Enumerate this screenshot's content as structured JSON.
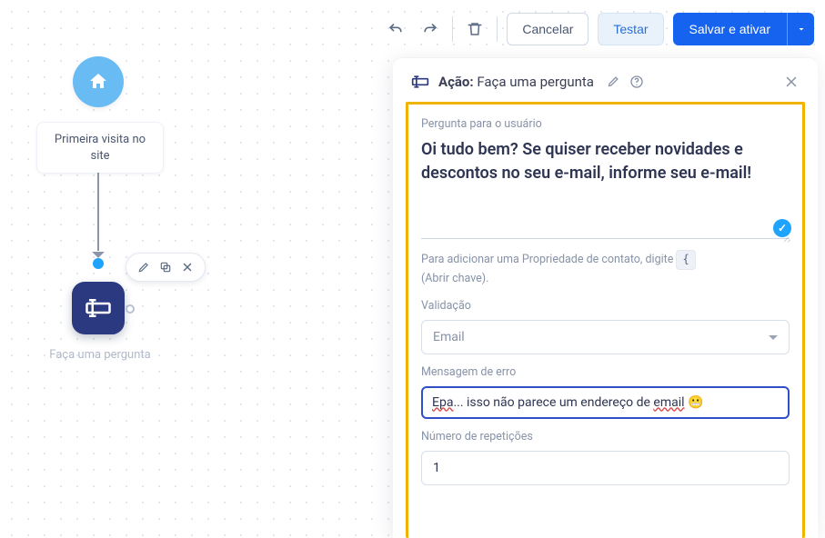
{
  "toolbar": {
    "cancel_label": "Cancelar",
    "test_label": "Testar",
    "save_label": "Salvar e ativar"
  },
  "flow": {
    "start_label": "Primeira visita no site",
    "action_label": "Faça uma pergunta"
  },
  "panel": {
    "header_prefix": "Ação:",
    "header_title": "Faça uma pergunta",
    "question_label": "Pergunta para o usuário",
    "question_value": "Oi tudo bem? Se quiser receber novidades e descontos no seu e-mail, informe seu e-mail!",
    "hint_before": "Para adicionar uma Propriedade de contato, digite",
    "hint_brace": "{",
    "hint_after": "(Abrir chave).",
    "validation_label": "Validação",
    "validation_value": "Email",
    "error_label": "Mensagem de erro",
    "error_plain": "Epa... isso não parece um endereço de email 😬",
    "error_parts": {
      "w1": "Epa",
      "mid": "... isso não parece um endereço de ",
      "w2": "email",
      "emoji": " 😬"
    },
    "repeat_label": "Número de repetições",
    "repeat_value": "1"
  },
  "colors": {
    "accent": "#f0b400",
    "primary": "#1663f0",
    "node": "#2b3a80"
  }
}
